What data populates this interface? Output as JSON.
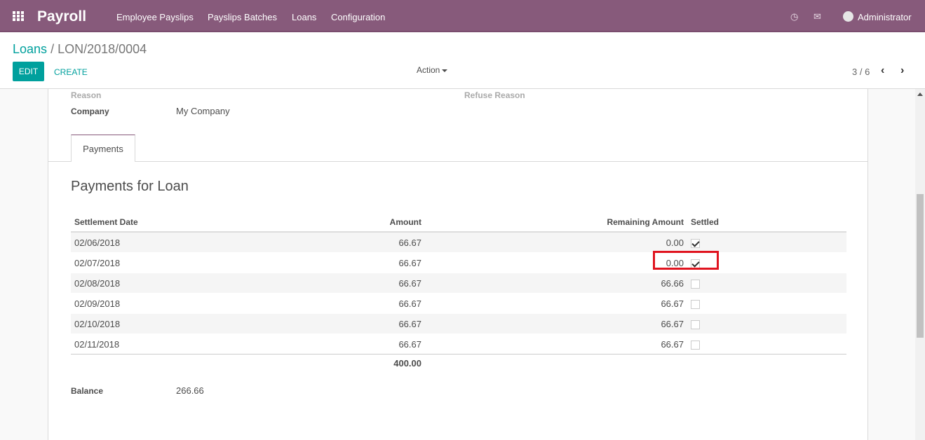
{
  "nav": {
    "brand": "Payroll",
    "menu": [
      "Employee Payslips",
      "Payslips Batches",
      "Loans",
      "Configuration"
    ],
    "user": "Administrator"
  },
  "breadcrumb": {
    "parent": "Loans",
    "separator": "/",
    "current": "LON/2018/0004"
  },
  "buttons": {
    "edit": "EDIT",
    "create": "CREATE",
    "action": "Action"
  },
  "pager": "3 / 6",
  "form": {
    "reason_label": "Reason",
    "refuse_reason_label": "Refuse Reason",
    "company_label": "Company",
    "company_value": "My Company",
    "balance_label": "Balance",
    "balance_value": "266.66"
  },
  "tab": "Payments",
  "section_title": "Payments for Loan",
  "table": {
    "headers": [
      "Settlement Date",
      "Amount",
      "Remaining Amount",
      "Settled"
    ],
    "rows": [
      {
        "date": "02/06/2018",
        "amount": "66.67",
        "remaining": "0.00",
        "settled": true
      },
      {
        "date": "02/07/2018",
        "amount": "66.67",
        "remaining": "0.00",
        "settled": true
      },
      {
        "date": "02/08/2018",
        "amount": "66.67",
        "remaining": "66.66",
        "settled": false
      },
      {
        "date": "02/09/2018",
        "amount": "66.67",
        "remaining": "66.67",
        "settled": false
      },
      {
        "date": "02/10/2018",
        "amount": "66.67",
        "remaining": "66.67",
        "settled": false
      },
      {
        "date": "02/11/2018",
        "amount": "66.67",
        "remaining": "66.67",
        "settled": false
      }
    ],
    "total_amount": "400.00"
  },
  "colors": {
    "brand": "#875a7b",
    "accent": "#00a09d",
    "highlight": "#e0141f"
  },
  "icons": [
    "apps-grid-icon",
    "clock-icon",
    "chat-icon",
    "user-avatar-icon",
    "chevron-left-icon",
    "chevron-right-icon"
  ]
}
